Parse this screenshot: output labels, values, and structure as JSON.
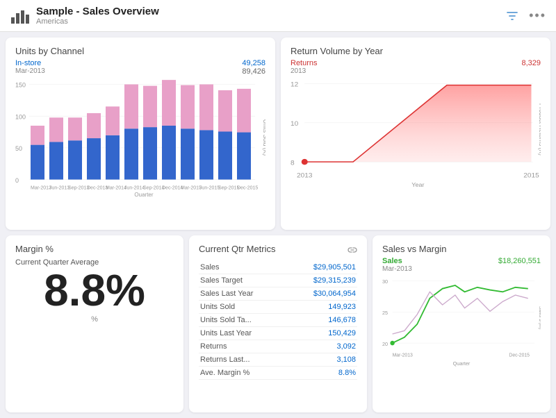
{
  "header": {
    "title": "Sample - Sales Overview",
    "subtitle": "Americas",
    "filter_icon": "filter",
    "more_icon": "more"
  },
  "units_by_channel": {
    "title": "Units by Channel",
    "selected_channel": "In-store",
    "selected_date": "Mar-2013",
    "value_blue": "49,258",
    "value_gray": "89,426",
    "x_label": "Quarter",
    "y_label": "Units Sold (K)",
    "y_ticks": [
      "150",
      "100",
      "50",
      "0"
    ],
    "x_ticks": [
      "Mar-2013",
      "Jun-2013",
      "Sep-2013",
      "Dec-2013",
      "Mar-2014",
      "Jun-2014",
      "Sep-2014",
      "Dec-2014",
      "Mar-2015",
      "Jun-2015",
      "Sep-2015",
      "Dec-2015"
    ],
    "bars": [
      {
        "blue": 55,
        "pink": 30
      },
      {
        "blue": 60,
        "pink": 38
      },
      {
        "blue": 62,
        "pink": 36
      },
      {
        "blue": 65,
        "pink": 40
      },
      {
        "blue": 70,
        "pink": 45
      },
      {
        "blue": 80,
        "pink": 70
      },
      {
        "blue": 82,
        "pink": 65
      },
      {
        "blue": 85,
        "pink": 72
      },
      {
        "blue": 80,
        "pink": 68
      },
      {
        "blue": 78,
        "pink": 72
      },
      {
        "blue": 76,
        "pink": 65
      },
      {
        "blue": 75,
        "pink": 68
      }
    ]
  },
  "return_volume": {
    "title": "Return Volume by Year",
    "label": "Returns",
    "date": "2013",
    "value": "8,329",
    "x_label": "Year",
    "y_label": "Product Returns (K)",
    "x_ticks": [
      "2013",
      "",
      "2015"
    ],
    "y_ticks": [
      "12",
      "10",
      "8"
    ]
  },
  "margin": {
    "title": "Margin %",
    "avg_label": "Current Quarter Average",
    "value": "8.8%",
    "footer": "%"
  },
  "metrics": {
    "title": "Current Qtr Metrics",
    "link_icon": "link",
    "rows": [
      {
        "label": "Sales",
        "value": "$29,905,501"
      },
      {
        "label": "Sales Target",
        "value": "$29,315,239"
      },
      {
        "label": "Sales Last Year",
        "value": "$30,064,954"
      },
      {
        "label": "Units Sold",
        "value": "149,923"
      },
      {
        "label": "Units Sold Ta...",
        "value": "146,678"
      },
      {
        "label": "Units Last Year",
        "value": "150,429"
      },
      {
        "label": "Returns",
        "value": "3,092"
      },
      {
        "label": "Returns Last...",
        "value": "3,108"
      },
      {
        "label": "Ave. Margin %",
        "value": "8.8%"
      }
    ]
  },
  "sales_vs_margin": {
    "title": "Sales vs Margin",
    "label": "Sales",
    "date": "Mar-2013",
    "value": "$18,260,551",
    "x_label": "Quarter",
    "y_label": "Sales $ (M)",
    "x_ticks": [
      "Mar-2013",
      "",
      "Dec-2015"
    ],
    "y_ticks": [
      "30",
      "25",
      "20"
    ]
  }
}
